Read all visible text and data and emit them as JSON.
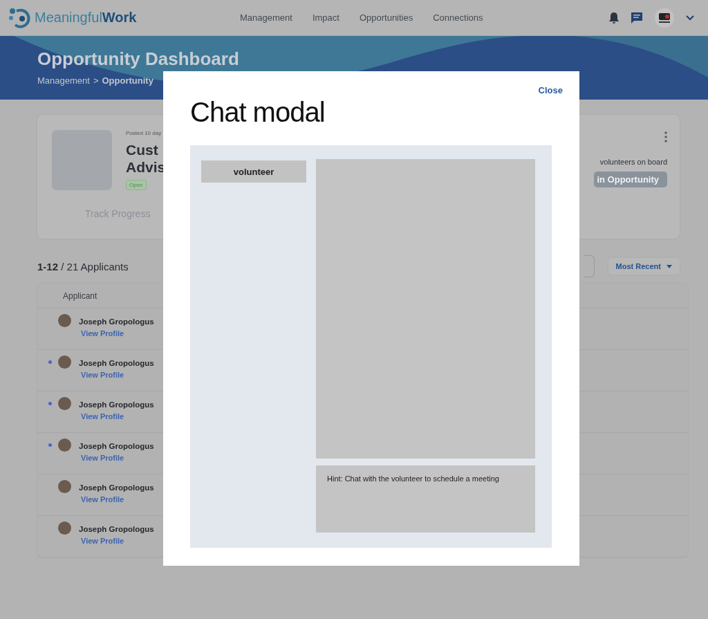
{
  "header": {
    "logo": "Meaningful**Work**",
    "nav": [
      "Management",
      "Impact",
      "Opportunities",
      "Connections"
    ]
  },
  "banner": {
    "title": "Opportunity Dashboard",
    "breadcrumb": [
      "Management",
      "Opportunity"
    ],
    "breadcrumb_separator": ">"
  },
  "opportunity_card": {
    "posted": "Posted 10 day",
    "title_lines": [
      "Cust",
      "Advis"
    ],
    "status": "Open",
    "track_progress": "Track Progress",
    "volunteers": "volunteers on board",
    "action_button": "in Opportunity"
  },
  "applicants": {
    "count": "**1-12** / 21 Applicants",
    "sort": "Most Recent",
    "column": "Applicant",
    "rows": [
      {
        "name": "Joseph Gropologus",
        "link": "View Profile",
        "unread": false
      },
      {
        "name": "Joseph Gropologus",
        "link": "View Profile",
        "unread": true
      },
      {
        "name": "Joseph Gropologus",
        "link": "View Profile",
        "unread": true
      },
      {
        "name": "Joseph Gropologus",
        "link": "View Profile",
        "unread": true
      },
      {
        "name": "Joseph Gropologus",
        "link": "View Profile",
        "unread": false
      },
      {
        "name": "Joseph Gropologus",
        "link": "View Profile",
        "unread": false
      }
    ]
  },
  "modal": {
    "title": "Chat modal",
    "close": "Close",
    "contacts": [
      "volunteer"
    ],
    "hint": "Hint: Chat with the volunteer to schedule a meeting"
  }
}
